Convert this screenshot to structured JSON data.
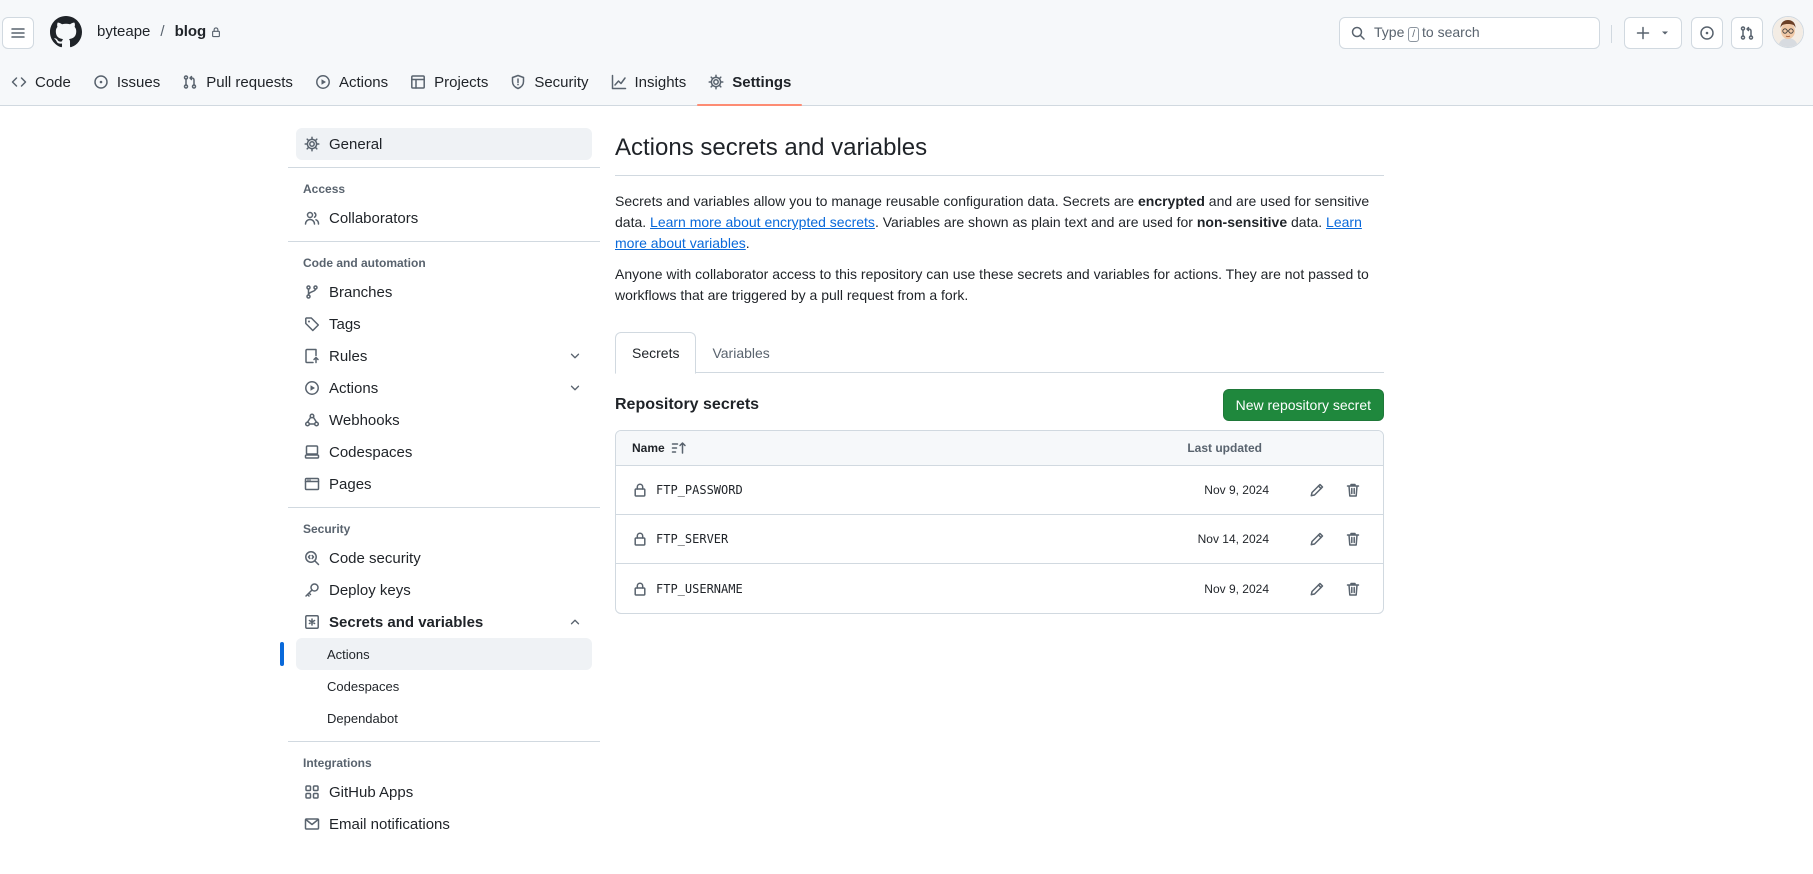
{
  "header": {
    "owner": "byteape",
    "separator": "/",
    "repo": "blog",
    "search": {
      "prefix": "Type",
      "key": "/",
      "suffix": "to search"
    }
  },
  "repo_tabs": [
    {
      "label": "Code",
      "icon": "code-icon"
    },
    {
      "label": "Issues",
      "icon": "issue-opened-icon"
    },
    {
      "label": "Pull requests",
      "icon": "git-pull-request-icon"
    },
    {
      "label": "Actions",
      "icon": "play-icon"
    },
    {
      "label": "Projects",
      "icon": "table-icon"
    },
    {
      "label": "Security",
      "icon": "shield-icon"
    },
    {
      "label": "Insights",
      "icon": "graph-icon"
    },
    {
      "label": "Settings",
      "icon": "gear-icon",
      "selected": true
    }
  ],
  "sidebar": {
    "general": "General",
    "access": {
      "heading": "Access",
      "collaborators": "Collaborators"
    },
    "code_automation": {
      "heading": "Code and automation",
      "branches": "Branches",
      "tags": "Tags",
      "rules": "Rules",
      "actions": "Actions",
      "webhooks": "Webhooks",
      "codespaces": "Codespaces",
      "pages": "Pages"
    },
    "security": {
      "heading": "Security",
      "code_security": "Code security",
      "deploy_keys": "Deploy keys",
      "secrets_variables": "Secrets and variables",
      "sub": {
        "actions": "Actions",
        "codespaces": "Codespaces",
        "dependabot": "Dependabot"
      }
    },
    "integrations": {
      "heading": "Integrations",
      "github_apps": "GitHub Apps",
      "email_notifications": "Email notifications"
    }
  },
  "main": {
    "title": "Actions secrets and variables",
    "desc": {
      "p1": "Secrets and variables allow you to manage reusable configuration data. Secrets are ",
      "encrypted": "encrypted",
      "p2": " and are used for sensitive data. ",
      "link1": "Learn more about encrypted secrets",
      "p3": ". Variables are shown as plain text and are used for ",
      "non_sensitive": "non-sensitive",
      "p4": " data. ",
      "link2": "Learn more about variables",
      "p5": "."
    },
    "desc2": "Anyone with collaborator access to this repository can use these secrets and variables for actions. They are not passed to workflows that are triggered by a pull request from a fork.",
    "tabs": {
      "secrets": "Secrets",
      "variables": "Variables"
    },
    "repo_secrets_title": "Repository secrets",
    "new_secret_button": "New repository secret",
    "table": {
      "col_name": "Name",
      "col_updated": "Last updated",
      "rows": [
        {
          "name": "FTP_PASSWORD",
          "updated": "Nov 9, 2024"
        },
        {
          "name": "FTP_SERVER",
          "updated": "Nov 14, 2024"
        },
        {
          "name": "FTP_USERNAME",
          "updated": "Nov 9, 2024"
        }
      ]
    }
  },
  "colors": {
    "accent": "#0969da",
    "primary_button": "#1f883d",
    "tab_underline": "#fd8c73"
  }
}
